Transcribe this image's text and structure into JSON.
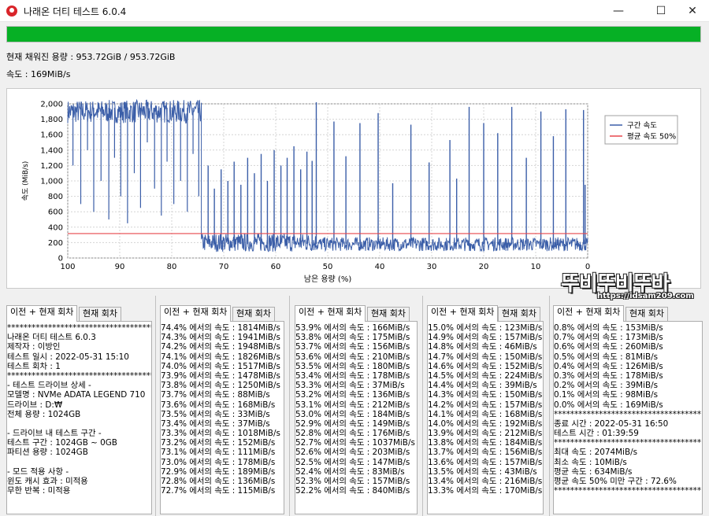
{
  "window": {
    "title": "나래온 더티 테스트 6.0.4",
    "minimize_glyph": "—",
    "maximize_glyph": "☐",
    "close_glyph": "✕"
  },
  "progress": {
    "fraction": 1.0,
    "color": "#06b025"
  },
  "status": {
    "filled_capacity": "현재 채워진 용량 : 953.72GiB / 953.72GiB",
    "speed": "속도 : 169MiB/s"
  },
  "chart_data": {
    "type": "line",
    "xlabel": "남은 용량 (%)",
    "ylabel": "속도 (MiB/s)",
    "xlim": [
      100,
      0
    ],
    "ylim": [
      0,
      2000
    ],
    "x_ticks": [
      100,
      90,
      80,
      70,
      60,
      50,
      40,
      30,
      20,
      10,
      0
    ],
    "y_ticks": [
      0,
      200,
      400,
      600,
      800,
      1000,
      1200,
      1400,
      1600,
      1800,
      2000
    ],
    "y_tick_labels": [
      "0",
      "200",
      "400",
      "600",
      "800",
      "1,000",
      "1,200",
      "1,400",
      "1,600",
      "1,800",
      "2,000"
    ],
    "grid": true,
    "legend_position": "right",
    "series": [
      {
        "name": "구간 속도",
        "color": "#3b5ea8",
        "segments": [
          {
            "x_from": 100,
            "x_to": 74.3,
            "base": 1900,
            "noise": 150
          },
          {
            "x_from": 74.3,
            "x_to": 52.0,
            "base": 200,
            "noise": 120
          },
          {
            "x_from": 52.0,
            "x_to": 0,
            "base": 180,
            "noise": 90
          }
        ],
        "dips": [
          {
            "x": 99.0,
            "y": 1200
          },
          {
            "x": 97.5,
            "y": 700
          },
          {
            "x": 96.2,
            "y": 1400
          },
          {
            "x": 95.0,
            "y": 600
          },
          {
            "x": 93.6,
            "y": 1000
          },
          {
            "x": 92.1,
            "y": 500
          },
          {
            "x": 91.0,
            "y": 1300
          },
          {
            "x": 89.8,
            "y": 800
          },
          {
            "x": 88.5,
            "y": 450
          },
          {
            "x": 87.2,
            "y": 1100
          },
          {
            "x": 86.0,
            "y": 650
          },
          {
            "x": 84.7,
            "y": 1500
          },
          {
            "x": 83.3,
            "y": 900
          },
          {
            "x": 82.0,
            "y": 550
          },
          {
            "x": 80.9,
            "y": 1250
          },
          {
            "x": 79.6,
            "y": 700
          },
          {
            "x": 78.3,
            "y": 1000
          },
          {
            "x": 77.0,
            "y": 600
          },
          {
            "x": 75.9,
            "y": 1350
          },
          {
            "x": 74.8,
            "y": 800
          }
        ],
        "spikes": [
          {
            "x": 73.0,
            "y": 1200
          },
          {
            "x": 71.8,
            "y": 900
          },
          {
            "x": 70.5,
            "y": 1150
          },
          {
            "x": 69.2,
            "y": 1000
          },
          {
            "x": 68.0,
            "y": 1250
          },
          {
            "x": 66.7,
            "y": 950
          },
          {
            "x": 65.4,
            "y": 1300
          },
          {
            "x": 64.1,
            "y": 1100
          },
          {
            "x": 62.8,
            "y": 1350
          },
          {
            "x": 61.6,
            "y": 1000
          },
          {
            "x": 60.3,
            "y": 1400
          },
          {
            "x": 59.0,
            "y": 1200
          },
          {
            "x": 57.8,
            "y": 1300
          },
          {
            "x": 56.5,
            "y": 1450
          },
          {
            "x": 55.2,
            "y": 1150
          },
          {
            "x": 54.0,
            "y": 1380
          },
          {
            "x": 53.0,
            "y": 1260
          },
          {
            "x": 52.2,
            "y": 2020
          },
          {
            "x": 48.8,
            "y": 1770
          },
          {
            "x": 46.5,
            "y": 1320
          },
          {
            "x": 43.8,
            "y": 1750
          },
          {
            "x": 40.3,
            "y": 1880
          },
          {
            "x": 37.5,
            "y": 970
          },
          {
            "x": 34.0,
            "y": 1730
          },
          {
            "x": 30.5,
            "y": 1240
          },
          {
            "x": 26.5,
            "y": 1530
          },
          {
            "x": 25.2,
            "y": 1030
          },
          {
            "x": 22.8,
            "y": 1960
          },
          {
            "x": 20.0,
            "y": 1750
          },
          {
            "x": 17.3,
            "y": 1620
          },
          {
            "x": 14.6,
            "y": 1960
          },
          {
            "x": 11.8,
            "y": 1300
          },
          {
            "x": 9.0,
            "y": 1900
          },
          {
            "x": 6.6,
            "y": 1580
          },
          {
            "x": 4.2,
            "y": 1930
          },
          {
            "x": 0.8,
            "y": 1920
          },
          {
            "x": 0.5,
            "y": 950
          }
        ]
      },
      {
        "name": "평균 속도 50%",
        "color": "#e8474c",
        "value": 317
      }
    ]
  },
  "panels": [
    {
      "tab_all": "이전 + 현재 회차",
      "tab_current": "현재 회차",
      "lines": [
        "************************************",
        "나래온 더티 테스트 6.0.3",
        "제작자 : 이방인",
        "테스트 일시 : 2022-05-31 15:10",
        "테스트 회차 : 1",
        "************************************",
        "- 테스트 드라이브 상세 -",
        "모델명 : NVMe     ADATA LEGEND 710",
        "드라이브 : D:₩",
        "전체 용량 : 1024GB",
        "",
        "- 드라이브 내 테스트 구간 -",
        "테스트 구간 : 1024GB ~ 0GB",
        "파티션 용량 : 1024GB",
        "",
        "- 모드 적용 사항 -",
        "윈도 캐시 효과 : 미적용",
        "무한 반복 : 미적용"
      ]
    },
    {
      "tab_all": "이전 + 현재 회차",
      "tab_current": "현재 회차",
      "lines": [
        "74.4% 에서의 속도 : 1814MiB/s",
        "74.3% 에서의 속도 : 1941MiB/s",
        "74.2% 에서의 속도 : 1948MiB/s",
        "74.1% 에서의 속도 : 1826MiB/s",
        "74.0% 에서의 속도 : 1517MiB/s",
        "73.9% 에서의 속도 : 1478MiB/s",
        "73.8% 에서의 속도 : 1250MiB/s",
        "73.7% 에서의 속도 : 88MiB/s",
        "73.6% 에서의 속도 : 168MiB/s",
        "73.5% 에서의 속도 : 33MiB/s",
        "73.4% 에서의 속도 : 37MiB/s",
        "73.3% 에서의 속도 : 1018MiB/s",
        "73.2% 에서의 속도 : 152MiB/s",
        "73.1% 에서의 속도 : 111MiB/s",
        "73.0% 에서의 속도 : 178MiB/s",
        "72.9% 에서의 속도 : 189MiB/s",
        "72.8% 에서의 속도 : 136MiB/s",
        "72.7% 에서의 속도 : 115MiB/s"
      ]
    },
    {
      "tab_all": "이전 + 현재 회차",
      "tab_current": "현재 회차",
      "lines": [
        "53.9% 에서의 속도 : 166MiB/s",
        "53.8% 에서의 속도 : 175MiB/s",
        "53.7% 에서의 속도 : 156MiB/s",
        "53.6% 에서의 속도 : 210MiB/s",
        "53.5% 에서의 속도 : 180MiB/s",
        "53.4% 에서의 속도 : 178MiB/s",
        "53.3% 에서의 속도 : 37MiB/s",
        "53.2% 에서의 속도 : 136MiB/s",
        "53.1% 에서의 속도 : 212MiB/s",
        "53.0% 에서의 속도 : 184MiB/s",
        "52.9% 에서의 속도 : 149MiB/s",
        "52.8% 에서의 속도 : 176MiB/s",
        "52.7% 에서의 속도 : 1037MiB/s",
        "52.6% 에서의 속도 : 203MiB/s",
        "52.5% 에서의 속도 : 147MiB/s",
        "52.4% 에서의 속도 : 83MiB/s",
        "52.3% 에서의 속도 : 157MiB/s",
        "52.2% 에서의 속도 : 840MiB/s"
      ]
    },
    {
      "tab_all": "이전 + 현재 회차",
      "tab_current": "현재 회차",
      "lines": [
        "15.0% 에서의 속도 : 123MiB/s",
        "14.9% 에서의 속도 : 157MiB/s",
        "14.8% 에서의 속도 : 46MiB/s",
        "14.7% 에서의 속도 : 150MiB/s",
        "14.6% 에서의 속도 : 152MiB/s",
        "14.5% 에서의 속도 : 224MiB/s",
        "14.4% 에서의 속도 : 39MiB/s",
        "14.3% 에서의 속도 : 150MiB/s",
        "14.2% 에서의 속도 : 157MiB/s",
        "14.1% 에서의 속도 : 168MiB/s",
        "14.0% 에서의 속도 : 192MiB/s",
        "13.9% 에서의 속도 : 212MiB/s",
        "13.8% 에서의 속도 : 184MiB/s",
        "13.7% 에서의 속도 : 156MiB/s",
        "13.6% 에서의 속도 : 157MiB/s",
        "13.5% 에서의 속도 : 43MiB/s",
        "13.4% 에서의 속도 : 216MiB/s",
        "13.3% 에서의 속도 : 170MiB/s"
      ]
    },
    {
      "tab_all": "이전 + 현재 회차",
      "tab_current": "현재 회차",
      "lines": [
        "0.8% 에서의 속도 : 153MiB/s",
        "0.7% 에서의 속도 : 173MiB/s",
        "0.6% 에서의 속도 : 260MiB/s",
        "0.5% 에서의 속도 : 81MiB/s",
        "0.4% 에서의 속도 : 126MiB/s",
        "0.3% 에서의 속도 : 178MiB/s",
        "0.2% 에서의 속도 : 39MiB/s",
        "0.1% 에서의 속도 : 98MiB/s",
        "0.0% 에서의 속도 : 169MiB/s",
        "************************************",
        "종료 시간 : 2022-05-31 16:50",
        "테스트 시간 : 01:39:59",
        "************************************",
        "최대 속도 : 2074MiB/s",
        "최소 속도 : 10MiB/s",
        "평균 속도 : 634MiB/s",
        "평균 속도 50% 미만 구간 : 72.6%",
        "************************************"
      ]
    }
  ],
  "watermark": {
    "brand": "뚜비뚜비뚜바",
    "url": "https://idsam209.com"
  }
}
